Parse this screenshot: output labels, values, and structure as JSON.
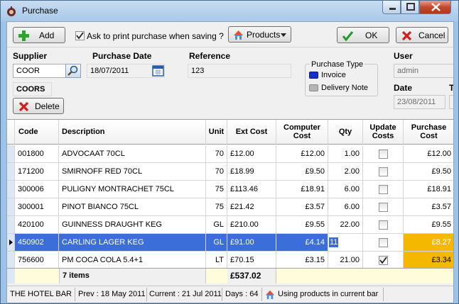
{
  "window": {
    "title": "Purchase"
  },
  "toolbar": {
    "add_label": "Add",
    "ask_print_label": "Ask to print purchase when saving ?",
    "ask_print_checked": true,
    "products_label": "Products",
    "ok_label": "OK",
    "cancel_label": "Cancel"
  },
  "header": {
    "supplier_label": "Supplier",
    "supplier_value": "COOR",
    "supplier_code": "COORS",
    "delete_label": "Delete",
    "purchase_date_label": "Purchase Date",
    "purchase_date_value": "18/07/2011",
    "reference_label": "Reference",
    "reference_value": "123",
    "purchase_type_label": "Purchase Type",
    "purchase_type_invoice": "Invoice",
    "purchase_type_delivery": "Delivery Note",
    "user_label": "User",
    "user_value": "admin",
    "date_label": "Date",
    "date_value": "23/08/2011",
    "cut_label": "T"
  },
  "grid": {
    "columns": [
      {
        "label": "Code"
      },
      {
        "label": "Description"
      },
      {
        "label": "Unit"
      },
      {
        "label": "Ext Cost"
      },
      {
        "label": "Computer Cost"
      },
      {
        "label": "Qty"
      },
      {
        "label": "Update Costs"
      },
      {
        "label": "Purchase Cost"
      }
    ],
    "rows": [
      {
        "code": "001800",
        "description": "ADVOCAAT 70CL",
        "unit": "70",
        "ext_cost": "£12.00",
        "computer_cost": "£12.00",
        "qty": "1.00",
        "update": false,
        "purchase_cost": "£12.00"
      },
      {
        "code": "171200",
        "description": "SMIRNOFF RED 70CL",
        "unit": "70",
        "ext_cost": "£18.99",
        "computer_cost": "£9.50",
        "qty": "2.00",
        "update": false,
        "purchase_cost": "£9.50"
      },
      {
        "code": "300006",
        "description": "PULIGNY MONTRACHET 75CL",
        "unit": "75",
        "ext_cost": "£113.46",
        "computer_cost": "£18.91",
        "qty": "6.00",
        "update": false,
        "purchase_cost": "£18.91"
      },
      {
        "code": "300001",
        "description": "PINOT BIANCO 75CL",
        "unit": "75",
        "ext_cost": "£21.42",
        "computer_cost": "£3.57",
        "qty": "6.00",
        "update": false,
        "purchase_cost": "£3.57"
      },
      {
        "code": "420100",
        "description": "GUINNESS DRAUGHT KEG",
        "unit": "GL",
        "ext_cost": "£210.00",
        "computer_cost": "£9.55",
        "qty": "22.00",
        "update": false,
        "purchase_cost": "£9.55"
      },
      {
        "code": "450902",
        "description": "CARLING LAGER KEG",
        "unit": "GL",
        "ext_cost": "£91.00",
        "computer_cost": "£4.14",
        "qty": "11",
        "update": false,
        "purchase_cost": "£8.27"
      },
      {
        "code": "756600",
        "description": "PM COCA COLA 5.4+1",
        "unit": "LT",
        "ext_cost": "£70.15",
        "computer_cost": "£3.15",
        "qty": "21.00",
        "update": true,
        "purchase_cost": "£3.34"
      }
    ],
    "totals": {
      "items": "7 items",
      "ext_cost": "£537.02"
    }
  },
  "status": {
    "venue": "THE HOTEL BAR",
    "prev": "Prev : 18 May 2011",
    "current": "Current : 21 Jul 2011",
    "days": "Days : 64",
    "message": "Using products in current bar"
  },
  "colors": {
    "selected_row": "#3b6ed8",
    "purchase_cost_highlight": "#f5b800",
    "totals_bg": "#fffcdc"
  }
}
